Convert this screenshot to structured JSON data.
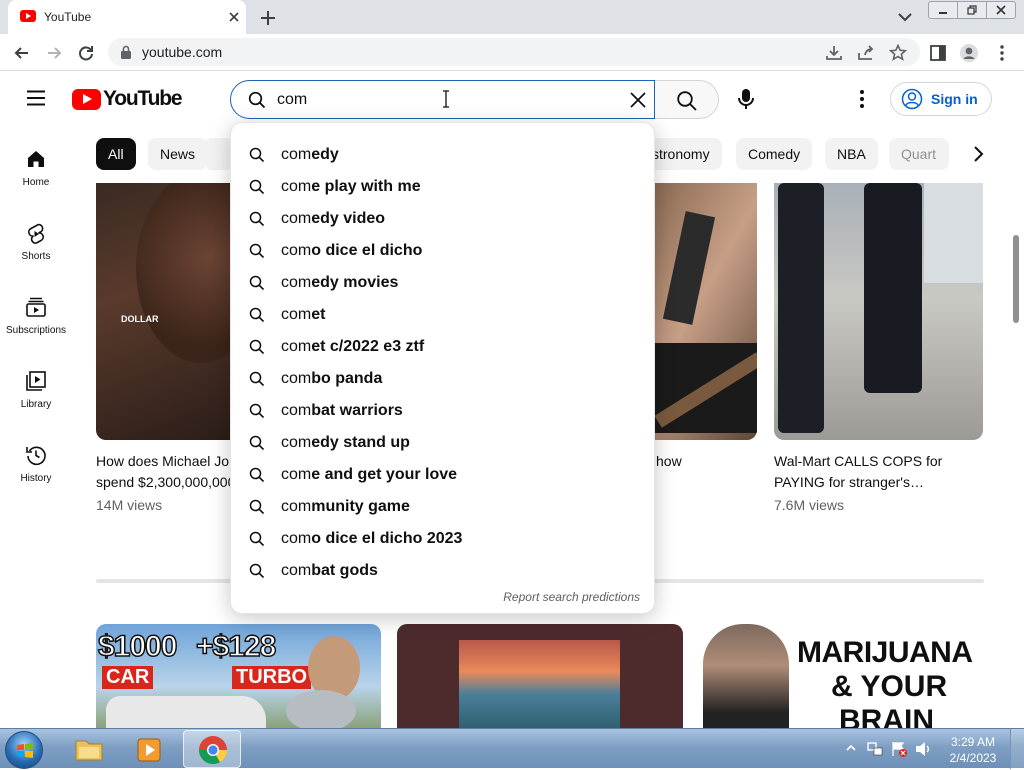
{
  "browser": {
    "tab_title": "YouTube",
    "url": "youtube.com"
  },
  "header": {
    "logo_text": "YouTube",
    "search_value": "com",
    "signin_label": "Sign in"
  },
  "nav": [
    {
      "label": "Home",
      "icon": "home-icon"
    },
    {
      "label": "Shorts",
      "icon": "shorts-icon"
    },
    {
      "label": "Subscriptions",
      "icon": "subscriptions-icon"
    },
    {
      "label": "Library",
      "icon": "library-icon"
    },
    {
      "label": "History",
      "icon": "history-icon"
    }
  ],
  "chips": [
    "All",
    "News",
    "stronomy",
    "Comedy",
    "NBA",
    "Quart"
  ],
  "suggestions": [
    {
      "typed": "com",
      "rest": "edy"
    },
    {
      "typed": "com",
      "rest": "e play with me"
    },
    {
      "typed": "com",
      "rest": "edy video"
    },
    {
      "typed": "com",
      "rest": "o dice el dicho"
    },
    {
      "typed": "com",
      "rest": "edy movies"
    },
    {
      "typed": "com",
      "rest": "et"
    },
    {
      "typed": "com",
      "rest": "et c/2022 e3 ztf"
    },
    {
      "typed": "com",
      "rest": "bo panda"
    },
    {
      "typed": "com",
      "rest": "bat warriors"
    },
    {
      "typed": "com",
      "rest": "edy stand up"
    },
    {
      "typed": "com",
      "rest": "e and get your love"
    },
    {
      "typed": "com",
      "rest": "munity game"
    },
    {
      "typed": "com",
      "rest": "o dice el dicho 2023"
    },
    {
      "typed": "com",
      "rest": "bat gods"
    }
  ],
  "report_label": "Report search predictions",
  "videos": [
    {
      "title_line1": "How does Michael Jo",
      "title_line2": "spend $2,300,000,000",
      "views": "14M views",
      "thumb_caption": "DOLLAR"
    },
    {
      "title_line1": "how",
      "title_line2": "",
      "views": ""
    },
    {
      "title_line1": "Wal-Mart CALLS COPS for",
      "title_line2": "PAYING for stranger's…",
      "views": "7.6M views"
    }
  ],
  "row2_thumbs": [
    {
      "text_a": "$1000",
      "text_b": "+$128",
      "text_c": "CAR",
      "text_d": "TURBO"
    },
    {},
    {
      "text_a": "MARIJUANA",
      "text_b": "& YOUR",
      "text_c": "BRAIN"
    }
  ],
  "taskbar": {
    "time": "3:29 AM",
    "date": "2/4/2023"
  },
  "colors": {
    "brand_red": "#ff0000",
    "search_focus_blue": "#1c62b9",
    "signin_blue": "#065fd4"
  }
}
